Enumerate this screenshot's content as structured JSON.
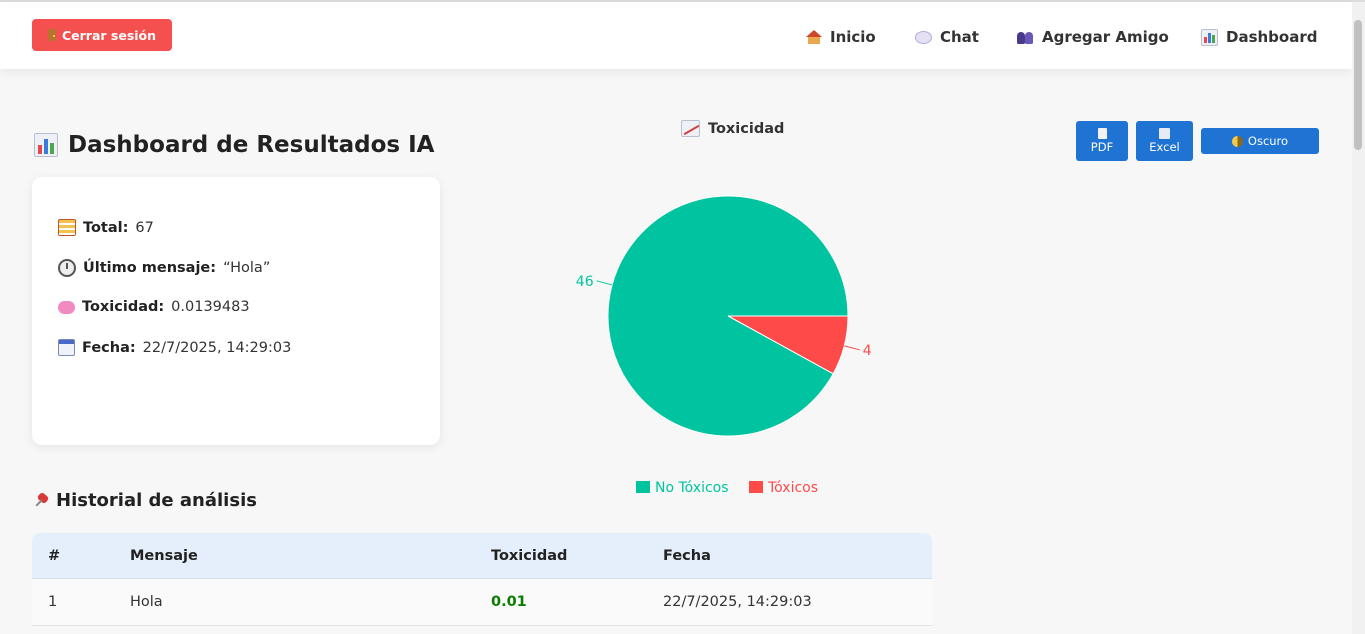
{
  "navbar": {
    "logout_label": "Cerrar sesión",
    "links": [
      {
        "label": "Inicio",
        "icon": "house-icon"
      },
      {
        "label": "Chat",
        "icon": "speech-bubble-icon"
      },
      {
        "label": "Agregar Amigo",
        "icon": "people-icon"
      },
      {
        "label": "Dashboard",
        "icon": "bar-chart-icon"
      }
    ]
  },
  "page": {
    "title": "Dashboard de Resultados IA"
  },
  "summary": {
    "total_label": "Total:",
    "total_value": "67",
    "last_label": "Último mensaje:",
    "last_value": "“Hola”",
    "tox_label": "Toxicidad:",
    "tox_value": "0.0139483",
    "date_label": "Fecha:",
    "date_value": "22/7/2025, 14:29:03"
  },
  "actions": {
    "pdf_label": "PDF",
    "excel_label": "Excel",
    "theme_label": "Oscuro"
  },
  "chart_data": {
    "type": "pie",
    "title": "Toxicidad",
    "categories": [
      "No Tóxicos",
      "Tóxicos"
    ],
    "values": [
      46,
      4
    ],
    "colors": [
      "#00c49f",
      "#ff4a4a"
    ],
    "legend_position": "bottom"
  },
  "history": {
    "title": "Historial de análisis",
    "columns": [
      "#",
      "Mensaje",
      "Toxicidad",
      "Fecha"
    ],
    "rows": [
      {
        "index": "1",
        "message": "Hola",
        "toxicity": "0.01",
        "date": "22/7/2025, 14:29:03"
      }
    ]
  },
  "colors": {
    "accent": "#1f74d3",
    "danger": "#f55050",
    "safe": "#00c49f",
    "toxic": "#ff4a4a"
  }
}
